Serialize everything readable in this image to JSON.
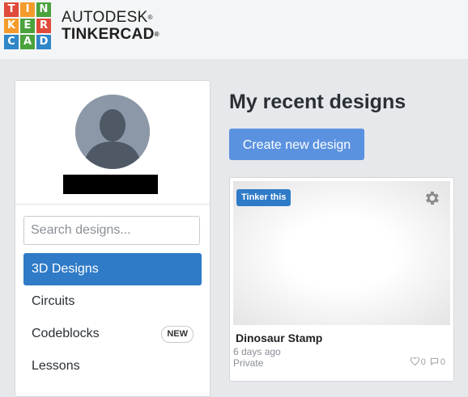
{
  "header": {
    "logo_letters": [
      "T",
      "I",
      "N",
      "K",
      "E",
      "R",
      "C",
      "A",
      "D"
    ],
    "logo_colors": [
      "#e04a3a",
      "#f59b2b",
      "#4aa23c",
      "#f59b2b",
      "#4aa23c",
      "#e04a3a",
      "#2f86c8",
      "#4aa23c",
      "#2f86c8"
    ],
    "brand_line1": "AUTODESK",
    "brand_line2": "TINKERCAD",
    "brand_reg": "®"
  },
  "sidebar": {
    "search_placeholder": "Search designs...",
    "items": [
      {
        "label": "3D Designs",
        "active": true
      },
      {
        "label": "Circuits"
      },
      {
        "label": "Codeblocks",
        "badge": "NEW"
      },
      {
        "label": "Lessons"
      }
    ]
  },
  "main": {
    "title": "My recent designs",
    "create_button": "Create new design",
    "card": {
      "badge": "Tinker this",
      "title": "Dinosaur Stamp",
      "time": "6 days ago",
      "privacy": "Private",
      "likes": "0",
      "comments": "0"
    }
  },
  "colors": {
    "accent": "#2f7bc8",
    "button": "#5a92e0",
    "background": "#e6e8eb"
  }
}
